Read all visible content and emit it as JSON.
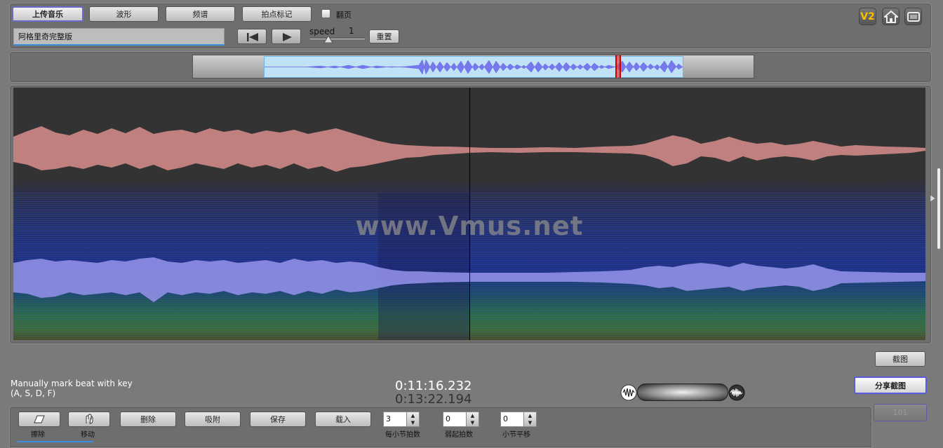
{
  "toolbar": {
    "upload_label": "上传音乐",
    "waveform_label": "波形",
    "spectrum_label": "频谱",
    "beat_mark_label": "拍点标记",
    "page_turn_label": "翻页",
    "song_name": "阿格里奇完整版",
    "speed_label": "speed",
    "speed_value": "1",
    "reset_label": "重置",
    "speed_level": 0.5
  },
  "top_right": {
    "version_badge": "V2",
    "home_icon": "home-icon",
    "screen_icon": "screen-icon"
  },
  "watermark": "www.Vmus.net",
  "actions": {
    "screenshot_label": "截图",
    "share_screenshot_label": "分享截图",
    "disabled_label": "101"
  },
  "info": {
    "hint_line1": "Manually mark beat with key",
    "hint_line2": "(A, S, D, F)",
    "current_time": "0:11:16.232",
    "total_time": "0:13:22.194"
  },
  "bottom": {
    "erase_label": "擦除",
    "move_label": "移动",
    "delete_label": "删除",
    "snap_label": "吸附",
    "save_label": "保存",
    "load_label": "载入",
    "beats_per_bar_value": "3",
    "beats_per_bar_label": "每小节拍数",
    "pickup_beats_value": "0",
    "pickup_beats_label": "弱起拍数",
    "bar_shift_value": "0",
    "bar_shift_label": "小节平移"
  },
  "colors": {
    "waveform_top": "#c98585",
    "waveform_bottom": "#8f8fe6",
    "accent_blue": "#3a8ee6",
    "selection": "#bfe2f6",
    "version_badge": "#f6c200"
  }
}
